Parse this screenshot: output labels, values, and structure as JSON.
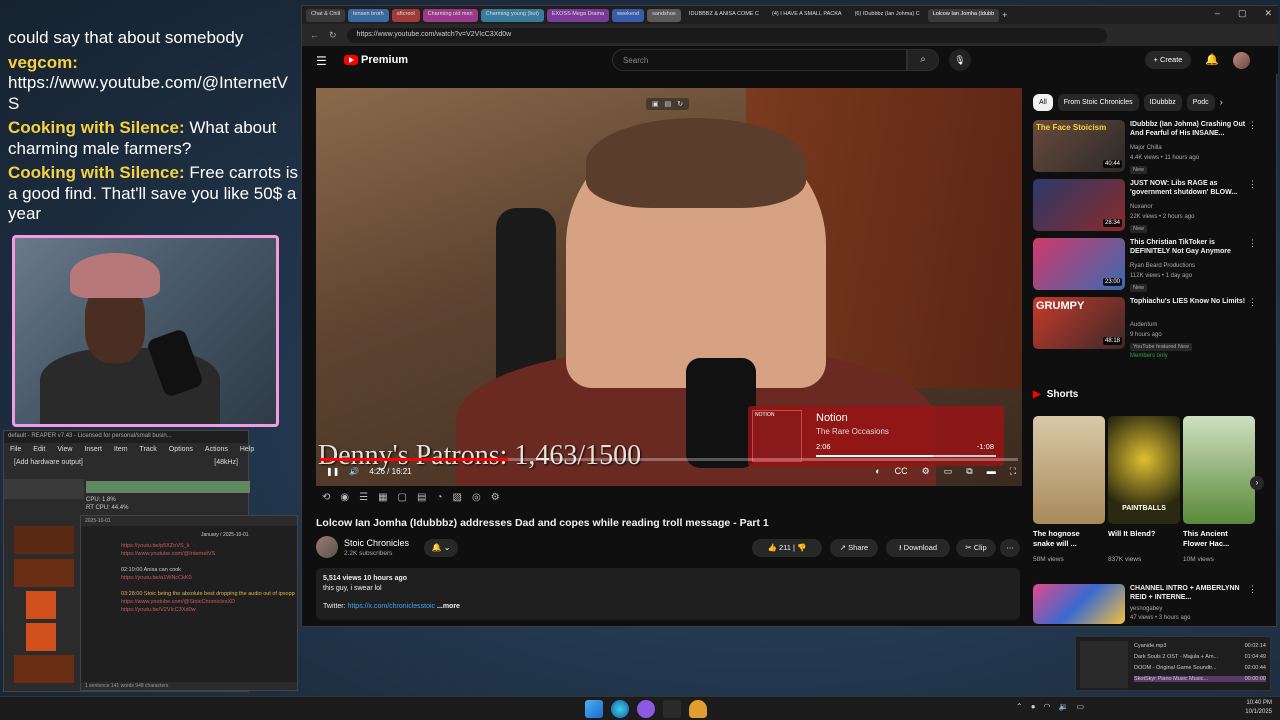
{
  "chat": [
    {
      "user": "",
      "text": "could say that about somebody"
    },
    {
      "user": "vegcom:",
      "text": "https://www.youtube.com/@InternetVS"
    },
    {
      "user": "Cooking with Silence:",
      "text": "What about charming male farmers?"
    },
    {
      "user": "Cooking with Silence:",
      "text": "Free carrots is a good find. That'll save you like 50$ a year"
    }
  ],
  "reaper": {
    "title": "default - REAPER v7.43 - Licensed for personal/small busin...",
    "menu": [
      "File",
      "Edit",
      "View",
      "Insert",
      "Item",
      "Track",
      "Options",
      "Actions",
      "Help"
    ],
    "hw": "[Add hardware output]",
    "rate": "[48kHz]",
    "cpu": "CPU: 1.8%",
    "rtcpu": "RT CPU: 44.4%"
  },
  "notes": {
    "date": "2025-10-01",
    "header": "January / 2025-10-01",
    "lines": [
      "https://youtu.be/p5XZoVS_k",
      "https://www.youtube.com/@InternetVS",
      "02:10:00 Anisa can cook",
      "https://youtu.be/a1WNcCkK0",
      "03:28:00 Stoic being the absolute best dropping the audio out of ipsopp",
      "https://www.youtube.com/@StoicChroniclesXD",
      "https://youtu.be/V2VIcC3Xd0w"
    ],
    "status": "1 sentence   141 words   948 characters"
  },
  "browser": {
    "tabs": [
      "Chat & Chill",
      "tensen broth",
      "aftcreol",
      "Charming old men",
      "Charming young (but)",
      "EXOSS Mega Drama",
      "weekend",
      "sandshoe",
      "IDUBBBZ & ANISA COME C",
      "(4) I HAVE A SMALL PACKA",
      "(6) IDubbbz (Ian Johma) C",
      "Lolcow Ian Jomha (Idubb"
    ],
    "active_tab": 11,
    "url": "https://www.youtube.com/watch?v=V2VIcC3Xd0w"
  },
  "yt": {
    "logo": "Premium",
    "search_placeholder": "Search",
    "create": "Create",
    "video": {
      "patrons_overlay": "Denny's Patrons: 1,463/1500",
      "time": "4:26 / 16:21",
      "progress": 0.27,
      "card": {
        "tag": "NOTION",
        "title": "Notion",
        "sub": "The Rare Occasions",
        "pos": "2:06",
        "remain": "-1:08",
        "progress": 0.65
      }
    },
    "title": "Lolcow Ian Jomha (Idubbbz) addresses Dad and copes while reading troll message - Part 1",
    "channel": {
      "name": "Stoic Chronicles",
      "subs": "2.2K subscribers"
    },
    "likes": "211",
    "share": "Share",
    "download": "Download",
    "clip": "Clip",
    "desc": {
      "meta": "5,514 views  10 hours ago",
      "line1": "this guy, i swear lol",
      "twitter_label": "Twitter:",
      "twitter_link": "https://x.com/chroniclesstoic",
      "more": "...more"
    }
  },
  "sidebar": {
    "chips": [
      "All",
      "From Stoic Chronicles",
      "IDubbbz",
      "Podc"
    ],
    "recs": [
      {
        "thumb_text": "The Face Stoicism",
        "title": "IDubbbz (Ian Johma) Crashing Out And Fearful of His INSANE...",
        "channel": "Major Chilla",
        "meta": "4.4K views • 11 hours ago",
        "badge": "New",
        "duration": "40:44"
      },
      {
        "thumb_text": "",
        "title": "JUST NOW: Libs RAGE as 'government shutdown' BLOW...",
        "channel": "Nuxanor",
        "meta": "22K views • 2 hours ago",
        "badge": "New",
        "duration": "28:34"
      },
      {
        "thumb_text": "",
        "title": "This Christian TikToker is DEFINITELY Not Gay Anymore",
        "channel": "Ryan Beard Productions",
        "meta": "112K views • 1 day ago",
        "badge": "New",
        "duration": "23:00"
      },
      {
        "thumb_text": "GRUMPY",
        "title": "Tophiachu's LIES Know No Limits!",
        "channel": "Audentum",
        "meta": "9 hours ago",
        "badge": "YouTube featured  New",
        "badge2": "Members only",
        "duration": "48:18"
      }
    ],
    "shorts_title": "Shorts",
    "shorts": [
      {
        "title": "The hognose snake will ...",
        "views": "58M views"
      },
      {
        "title": "Will It Blend?",
        "views": "837K views",
        "thumb_text": "PAINTBALLS"
      },
      {
        "title": "This Ancient Flower Hac...",
        "views": "10M views"
      }
    ],
    "last": {
      "title": "CHANNEL INTRO + AMBERLYNN REID + INTERNE...",
      "channel": "yesnogabey",
      "meta": "47 views • 3 hours ago"
    }
  },
  "media": {
    "tracks": [
      {
        "name": "Cyanide.mp3",
        "dur": "00:02:14"
      },
      {
        "name": "Dark Souls 2 OST - Majula + Am...",
        "dur": "01:04:49"
      },
      {
        "name": "DOOM - Original Game Soundtr...",
        "dur": "02:00:44"
      },
      {
        "name": "SkotSkyr Piano Music Music...",
        "dur": "00:00:00"
      }
    ]
  },
  "taskbar": {
    "time": "10:40 PM",
    "date": "10/1/2025"
  }
}
